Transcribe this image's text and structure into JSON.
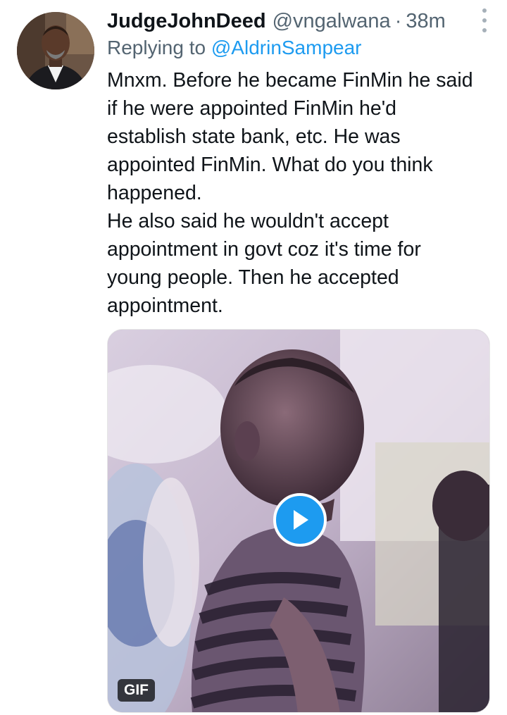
{
  "tweet": {
    "author": {
      "display_name": "JudgeJohnDeed",
      "handle": "@vngalwana",
      "separator": "·",
      "time": "38m"
    },
    "replying_to": {
      "prefix": "Replying to ",
      "mention": "@AldrinSampear"
    },
    "text_lines": [
      "Mnxm. Before he became FinMin he said",
      "if he were appointed FinMin he'd",
      "establish state bank, etc. He was",
      "appointed FinMin. What do you think",
      "happened.",
      "He also said he wouldn't accept",
      "appointment in govt coz it's time for",
      "young people. Then he accepted",
      "appointment."
    ],
    "media": {
      "badge": "GIF",
      "play_icon": "play-icon"
    },
    "icons": {
      "more": "more-vertical-icon"
    },
    "colors": {
      "accent": "#1d9bf0",
      "secondary_text": "#536471"
    }
  }
}
